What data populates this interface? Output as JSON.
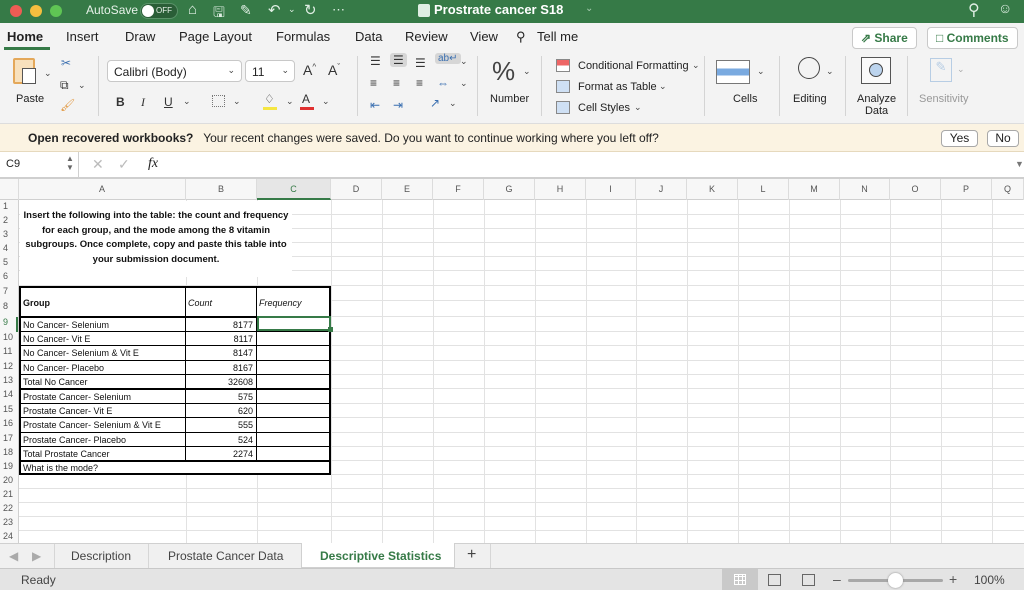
{
  "titlebar": {
    "autosave_label": "AutoSave",
    "autosave_state": "OFF",
    "doc_title": "Prostrate cancer S18",
    "more": "⋯"
  },
  "ribbon_tabs": [
    "Home",
    "Insert",
    "Draw",
    "Page Layout",
    "Formulas",
    "Data",
    "Review",
    "View"
  ],
  "tell_me": "Tell me",
  "share_label": "Share",
  "comments_label": "Comments",
  "ribbon": {
    "paste": "Paste",
    "font_name": "Calibri (Body)",
    "font_size": "11",
    "bold": "B",
    "italic": "I",
    "underline": "U",
    "number": "Number",
    "conditional_formatting": "Conditional Formatting",
    "format_as_table": "Format as Table",
    "cell_styles": "Cell Styles",
    "cells": "Cells",
    "editing": "Editing",
    "analyze_data_1": "Analyze",
    "analyze_data_2": "Data",
    "sensitivity": "Sensitivity",
    "fill_color": "#f5e642",
    "font_color": "#e03030"
  },
  "banner": {
    "title": "Open recovered workbooks?",
    "message": "Your recent changes were saved. Do you want to continue working where you left off?",
    "yes": "Yes",
    "no": "No"
  },
  "formula_bar": {
    "name_box": "C9",
    "fx": "fx",
    "value": ""
  },
  "columns": [
    "A",
    "B",
    "C",
    "D",
    "E",
    "F",
    "G",
    "H",
    "I",
    "J",
    "K",
    "L",
    "M",
    "N",
    "O",
    "P",
    "Q"
  ],
  "rows": [
    "1",
    "2",
    "3",
    "4",
    "5",
    "6",
    "7",
    "8",
    "9",
    "10",
    "11",
    "12",
    "13",
    "14",
    "15",
    "16",
    "17",
    "18",
    "19",
    "20",
    "21",
    "22",
    "23",
    "24"
  ],
  "instructions": "Insert the following into the table: the count and frequency for each group, and the mode among the 8 vitamin subgroups. Once complete, copy and paste this table into your submission document.",
  "table": {
    "headers": {
      "group": "Group",
      "count": "Count",
      "frequency": "Frequency"
    },
    "rows": [
      {
        "group": "No Cancer- Selenium",
        "count": "8177",
        "frequency": ""
      },
      {
        "group": "No Cancer- Vit E",
        "count": "8117",
        "frequency": ""
      },
      {
        "group": "No Cancer- Selenium & Vit E",
        "count": "8147",
        "frequency": ""
      },
      {
        "group": "No Cancer- Placebo",
        "count": "8167",
        "frequency": ""
      },
      {
        "group": "Total No Cancer",
        "count": "32608",
        "frequency": ""
      },
      {
        "group": "Prostate Cancer- Selenium",
        "count": "575",
        "frequency": ""
      },
      {
        "group": "Prostate Cancer- Vit E",
        "count": "620",
        "frequency": ""
      },
      {
        "group": "Prostate Cancer- Selenium & Vit E",
        "count": "555",
        "frequency": ""
      },
      {
        "group": "Prostate Cancer- Placebo",
        "count": "524",
        "frequency": ""
      },
      {
        "group": "Total Prostate Cancer",
        "count": "2274",
        "frequency": ""
      }
    ],
    "mode_label": "What is the mode?"
  },
  "sheet_tabs": [
    "Description",
    "Prostate Cancer Data",
    "Descriptive Statistics"
  ],
  "active_sheet": "Descriptive Statistics",
  "add_sheet": "+",
  "status": {
    "ready": "Ready",
    "zoom": "100%",
    "zoom_level_fraction": 0.5
  },
  "colors": {
    "accent": "#367a47",
    "banner_bg": "#fbf3e2"
  }
}
